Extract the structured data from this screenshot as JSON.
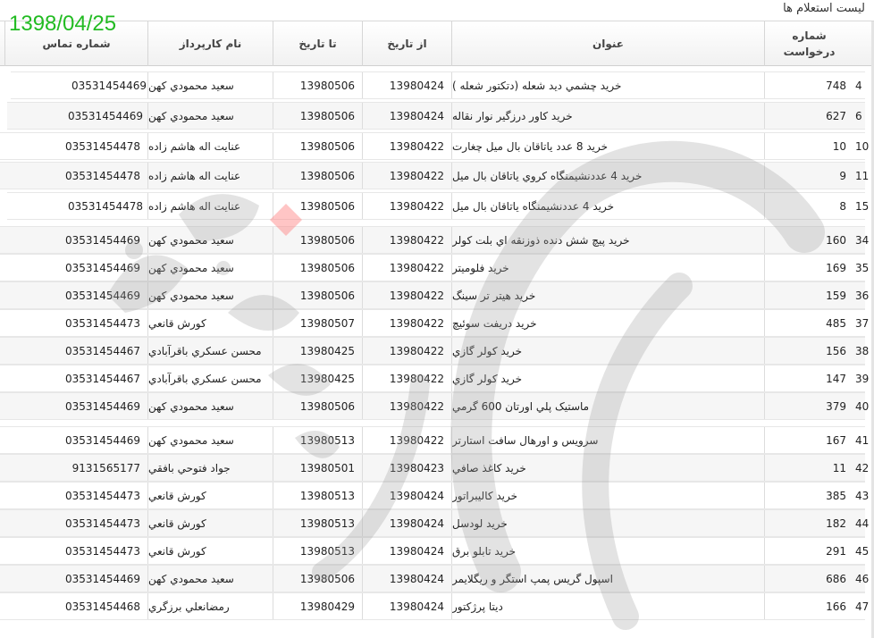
{
  "page": {
    "title": "لیست استعلام ها",
    "date_stamp": "1398/04/25"
  },
  "table": {
    "columns": {
      "request_no": "شماره درخواست",
      "subject": "عنوان",
      "from_date": "از تاريخ",
      "to_date": "تا تاريخ",
      "agent": "نام کارپرداز",
      "phone": "شماره تماس"
    },
    "rows": [
      {
        "idx": "4",
        "no": "748",
        "subject": "خريد چشمي ديد شعله (دتکتور شعله )",
        "from": "13980424",
        "to": "13980506",
        "agent": "سعيد محمودي کهن",
        "phone": "03531454469"
      },
      {
        "idx": "6",
        "no": "627",
        "subject": "خريد کاور درزگير نوار نقاله",
        "from": "13980424",
        "to": "13980506",
        "agent": "سعيد محمودي کهن",
        "phone": "03531454469"
      },
      {
        "idx": "10",
        "no": "10",
        "subject": "خريد 8 عدد ياتاقان بال ميل چغارت",
        "from": "13980422",
        "to": "13980506",
        "agent": "عنايت اله هاشم زاده",
        "phone": "03531454478"
      },
      {
        "idx": "11",
        "no": "9",
        "subject": "خريد 4 عددنشيمنگاه کروي ياتاقان بال ميل",
        "from": "13980422",
        "to": "13980506",
        "agent": "عنايت اله هاشم زاده",
        "phone": "03531454478"
      },
      {
        "idx": "15",
        "no": "8",
        "subject": "خريد 4 عددنشيمنگاه ياتاقان بال ميل",
        "from": "13980422",
        "to": "13980506",
        "agent": "عنايت اله هاشم زاده",
        "phone": "03531454478"
      },
      {
        "idx": "34",
        "no": "160",
        "subject": "خريد پيچ شش دنده ذوزنقه اي بلت کولر",
        "from": "13980422",
        "to": "13980506",
        "agent": "سعيد محمودي کهن",
        "phone": "03531454469"
      },
      {
        "idx": "35",
        "no": "169",
        "subject": "خريد فلوميتر",
        "from": "13980422",
        "to": "13980506",
        "agent": "سعيد محمودي کهن",
        "phone": "03531454469"
      },
      {
        "idx": "36",
        "no": "159",
        "subject": "خريد هيتر تر سينگ",
        "from": "13980422",
        "to": "13980506",
        "agent": "سعيد محمودي کهن",
        "phone": "03531454469"
      },
      {
        "idx": "37",
        "no": "485",
        "subject": "خريد دريفت سوئيچ",
        "from": "13980422",
        "to": "13980507",
        "agent": "کورش قانعي",
        "phone": "03531454473"
      },
      {
        "idx": "38",
        "no": "156",
        "subject": "خريد کولر گازي",
        "from": "13980422",
        "to": "13980425",
        "agent": "محسن عسکري باقرآبادي",
        "phone": "03531454467"
      },
      {
        "idx": "39",
        "no": "147",
        "subject": "خريد کولر گازي",
        "from": "13980422",
        "to": "13980425",
        "agent": "محسن عسکري باقرآبادي",
        "phone": "03531454467"
      },
      {
        "idx": "40",
        "no": "379",
        "subject": "ماستيک پلي اورتان 600 گرمي",
        "from": "13980422",
        "to": "13980506",
        "agent": "سعيد محمودي کهن",
        "phone": "03531454469"
      },
      {
        "idx": "41",
        "no": "167",
        "subject": "سرويس و اورهال سافت استارتر",
        "from": "13980422",
        "to": "13980513",
        "agent": "سعيد محمودي کهن",
        "phone": "03531454469"
      },
      {
        "idx": "42",
        "no": "11",
        "subject": "خريد کاغذ صافي",
        "from": "13980423",
        "to": "13980501",
        "agent": "جواد فتوحي بافقي",
        "phone": "9131565177"
      },
      {
        "idx": "43",
        "no": "385",
        "subject": "خريد کاليبراتور",
        "from": "13980424",
        "to": "13980513",
        "agent": "کورش قانعي",
        "phone": "03531454473"
      },
      {
        "idx": "44",
        "no": "182",
        "subject": "خريد لودسل",
        "from": "13980424",
        "to": "13980513",
        "agent": "کورش قانعي",
        "phone": "03531454473"
      },
      {
        "idx": "45",
        "no": "291",
        "subject": "خريد تابلو برق",
        "from": "13980424",
        "to": "13980513",
        "agent": "کورش قانعي",
        "phone": "03531454473"
      },
      {
        "idx": "46",
        "no": "686",
        "subject": "اسپول گريس پمپ استگر و ريگلايمر",
        "from": "13980424",
        "to": "13980506",
        "agent": "سعيد محمودي کهن",
        "phone": "03531454469"
      },
      {
        "idx": "47",
        "no": "166",
        "subject": "ديتا پرژکتور",
        "from": "13980424",
        "to": "13980429",
        "agent": "رمضانعلي برزگري",
        "phone": "03531454468"
      }
    ]
  }
}
